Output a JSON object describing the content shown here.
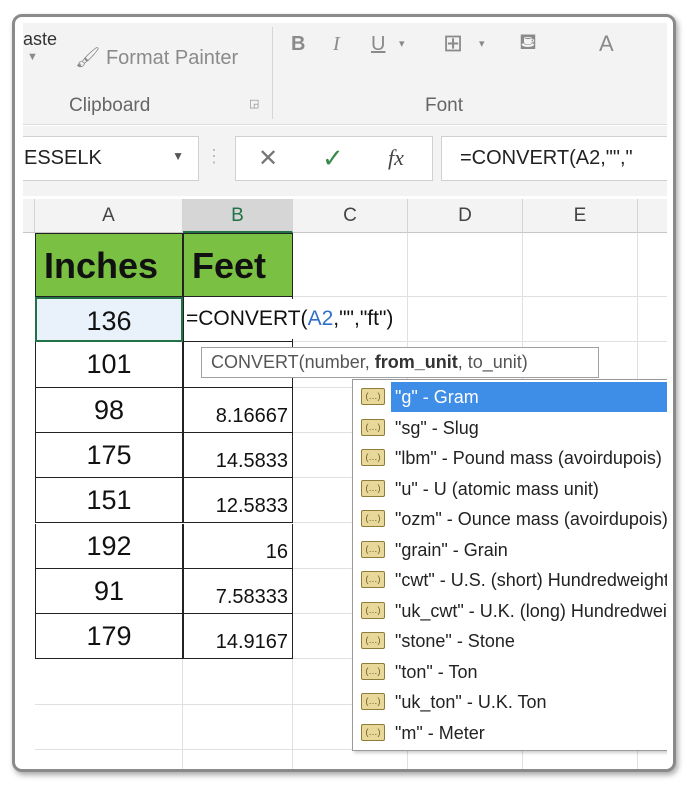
{
  "ribbon": {
    "paste_label": "aste",
    "format_painter": "Format Painter",
    "clipboard_group": "Clipboard",
    "font_group": "Font",
    "bold": "B",
    "italic": "I",
    "underline": "U",
    "font_color": "A"
  },
  "formula_bar": {
    "name_box": "ESSELK",
    "cancel": "✕",
    "enter": "✓",
    "fx": "fx",
    "formula": "=CONVERT(A2,\"\",\""
  },
  "columns": [
    "A",
    "B",
    "C",
    "D",
    "E"
  ],
  "selected_column": "B",
  "headers": {
    "a1": "Inches",
    "b1": "Feet"
  },
  "header_fill": "#7ac143",
  "rows": [
    {
      "inches": "136",
      "feet": ""
    },
    {
      "inches": "101",
      "feet": ""
    },
    {
      "inches": "98",
      "feet": "8.16667"
    },
    {
      "inches": "175",
      "feet": "14.5833"
    },
    {
      "inches": "151",
      "feet": "12.5833"
    },
    {
      "inches": "192",
      "feet": "16"
    },
    {
      "inches": "91",
      "feet": "7.58333"
    },
    {
      "inches": "179",
      "feet": "14.9167"
    }
  ],
  "edit_cell": {
    "prefix": "=CONVERT(",
    "ref": "A2",
    "suffix": ",\"\",\"ft\")"
  },
  "tooltip": {
    "fn": "CONVERT(number, ",
    "bold_arg": "from_unit",
    "rest": ", to_unit)"
  },
  "autocomplete": {
    "selected_index": 0,
    "items": [
      "\"g\" - Gram",
      "\"sg\" - Slug",
      "\"lbm\" - Pound mass (avoirdupois)",
      "\"u\" - U (atomic mass unit)",
      "\"ozm\" - Ounce mass (avoirdupois)",
      "\"grain\" - Grain",
      "\"cwt\" - U.S. (short) Hundredweight",
      "\"uk_cwt\" - U.K. (long) Hundredweight",
      "\"stone\" - Stone",
      "\"ton\" - Ton",
      "\"uk_ton\" - U.K. Ton",
      "\"m\" - Meter"
    ]
  }
}
